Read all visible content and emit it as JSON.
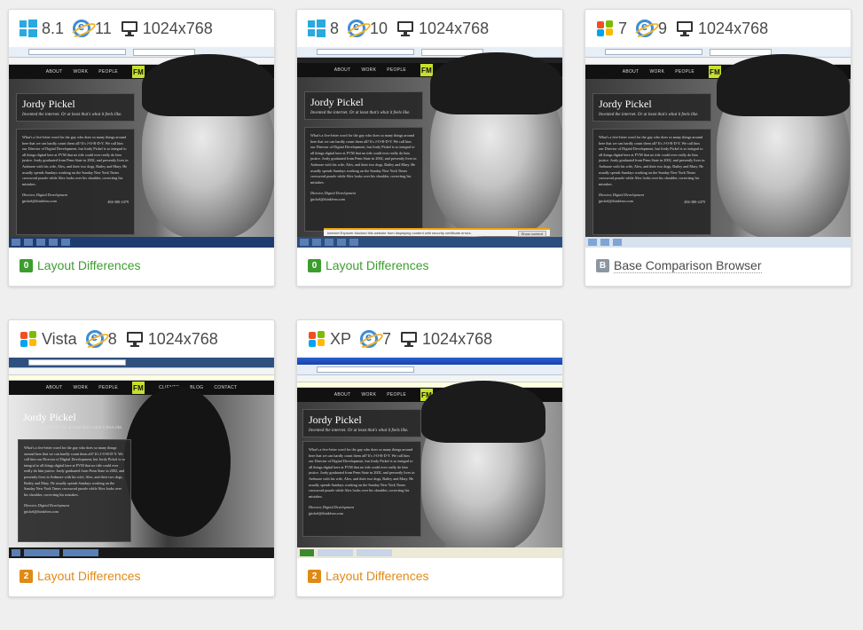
{
  "colors": {
    "green": "#3c9d2e",
    "orange": "#e08a16",
    "gray_badge": "#8c96a0",
    "ie_blue": "#3b8ed8",
    "win8_blue": "#2aa9e0",
    "site_logo": "#c7e02a"
  },
  "site": {
    "nav": [
      "ABOUT",
      "WORK",
      "PEOPLE",
      "CLIENTS",
      "BLOG",
      "CONTACT"
    ],
    "logo": "FM",
    "name": "Jordy Pickel",
    "tagline": "Invented the internet. Or at least that's what it feels like.",
    "bio": "What's a five-letter word for the guy who does so many things around here that we can hardly count them all? It's J-O-R-D-Y. We call him our Director of Digital Development, but Jordy Pickel is so integral to all things digital here at FVM that no title could ever really do him justice. Jordy graduated from Penn State in 2002, and presently lives in Ardmore with his wife, Alex, and their two dogs, Bailey and Mary. He usually spends Sundays working on the Sunday New York Times crossword puzzle while Alex looks over his shoulder, correcting his mistakes.",
    "role": "Director, Digital Development",
    "email": "jpickel@thinkfvm.com",
    "phone": "484-380-2479"
  },
  "cards": [
    {
      "os_icon": "windows8-icon",
      "os_label": "8.1",
      "browser_icon": "ie-icon",
      "browser_label": "11",
      "resolution": "1024x768",
      "badge": "0",
      "result": "Layout Differences",
      "status": "green"
    },
    {
      "os_icon": "windows8-icon",
      "os_label": "8",
      "browser_icon": "ie-icon",
      "browser_label": "10",
      "resolution": "1024x768",
      "badge": "0",
      "result": "Layout Differences",
      "status": "green",
      "notice": "Internet Explorer blocked this website from displaying content with security certificate errors.",
      "notice_button": "Show content"
    },
    {
      "os_icon": "windows7-icon",
      "os_label": "7",
      "browser_icon": "ie-icon",
      "browser_label": "9",
      "resolution": "1024x768",
      "badge": "B",
      "result": "Base Comparison Browser",
      "status": "gray"
    },
    {
      "os_icon": "windows-vista-icon",
      "os_label": "Vista",
      "browser_icon": "ie-icon",
      "browser_label": "8",
      "resolution": "1024x768",
      "badge": "2",
      "result": "Layout Differences",
      "status": "orange"
    },
    {
      "os_icon": "windows-xp-icon",
      "os_label": "XP",
      "browser_icon": "ie-icon",
      "browser_label": "7",
      "resolution": "1024x768",
      "badge": "2",
      "result": "Layout Differences",
      "status": "orange"
    }
  ]
}
